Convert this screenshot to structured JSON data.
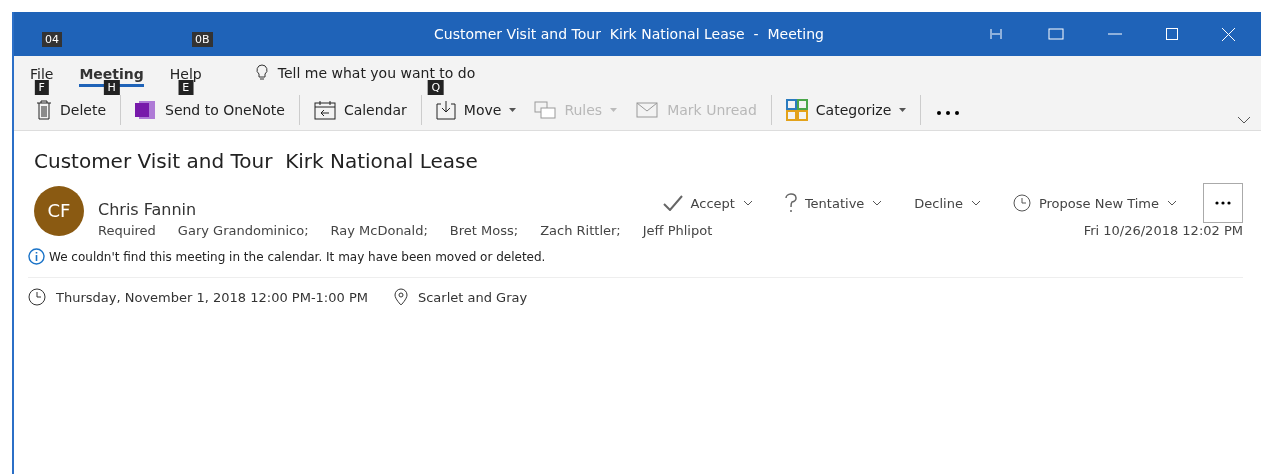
{
  "title_bar": {
    "keytips": [
      "04",
      "0B"
    ],
    "title": "Customer Visit and Tour  Kirk National Lease  -  Meeting"
  },
  "tabs": [
    {
      "label": "File",
      "keytip": "F",
      "selected": false
    },
    {
      "label": "Meeting",
      "keytip": "H",
      "selected": true
    },
    {
      "label": "Help",
      "keytip": "E",
      "selected": false
    }
  ],
  "tell_me": {
    "placeholder": "Tell me what you want to do",
    "keytip": "Q"
  },
  "ribbon": [
    {
      "label": "Delete",
      "disabled": false,
      "dropdown": false
    },
    {
      "label": "Send to OneNote",
      "disabled": false,
      "dropdown": false
    },
    {
      "label": "Calendar",
      "disabled": false,
      "dropdown": false
    },
    {
      "label": "Move",
      "disabled": false,
      "dropdown": true
    },
    {
      "label": "Rules",
      "disabled": true,
      "dropdown": true
    },
    {
      "label": "Mark Unread",
      "disabled": true,
      "dropdown": false
    },
    {
      "label": "Categorize",
      "disabled": false,
      "dropdown": true
    }
  ],
  "message": {
    "subject": "Customer Visit and Tour  Kirk National Lease",
    "avatar_initials": "CF",
    "sender": "Chris Fannin",
    "required_label": "Required",
    "attendees": [
      "Gary Grandominico;",
      "Ray McDonald;",
      "Bret Moss;",
      "Zach Rittler;",
      "Jeff Phlipot"
    ],
    "sent": "Fri 10/26/2018 12:02 PM",
    "responses": [
      {
        "label": "Accept"
      },
      {
        "label": "Tentative"
      },
      {
        "label": "Decline"
      },
      {
        "label": "Propose New Time"
      }
    ],
    "info": "We couldn't find this meeting in the calendar. It may have been moved or deleted.",
    "when": "Thursday, November 1, 2018 12:00 PM-1:00 PM",
    "location": "Scarlet and Gray"
  }
}
